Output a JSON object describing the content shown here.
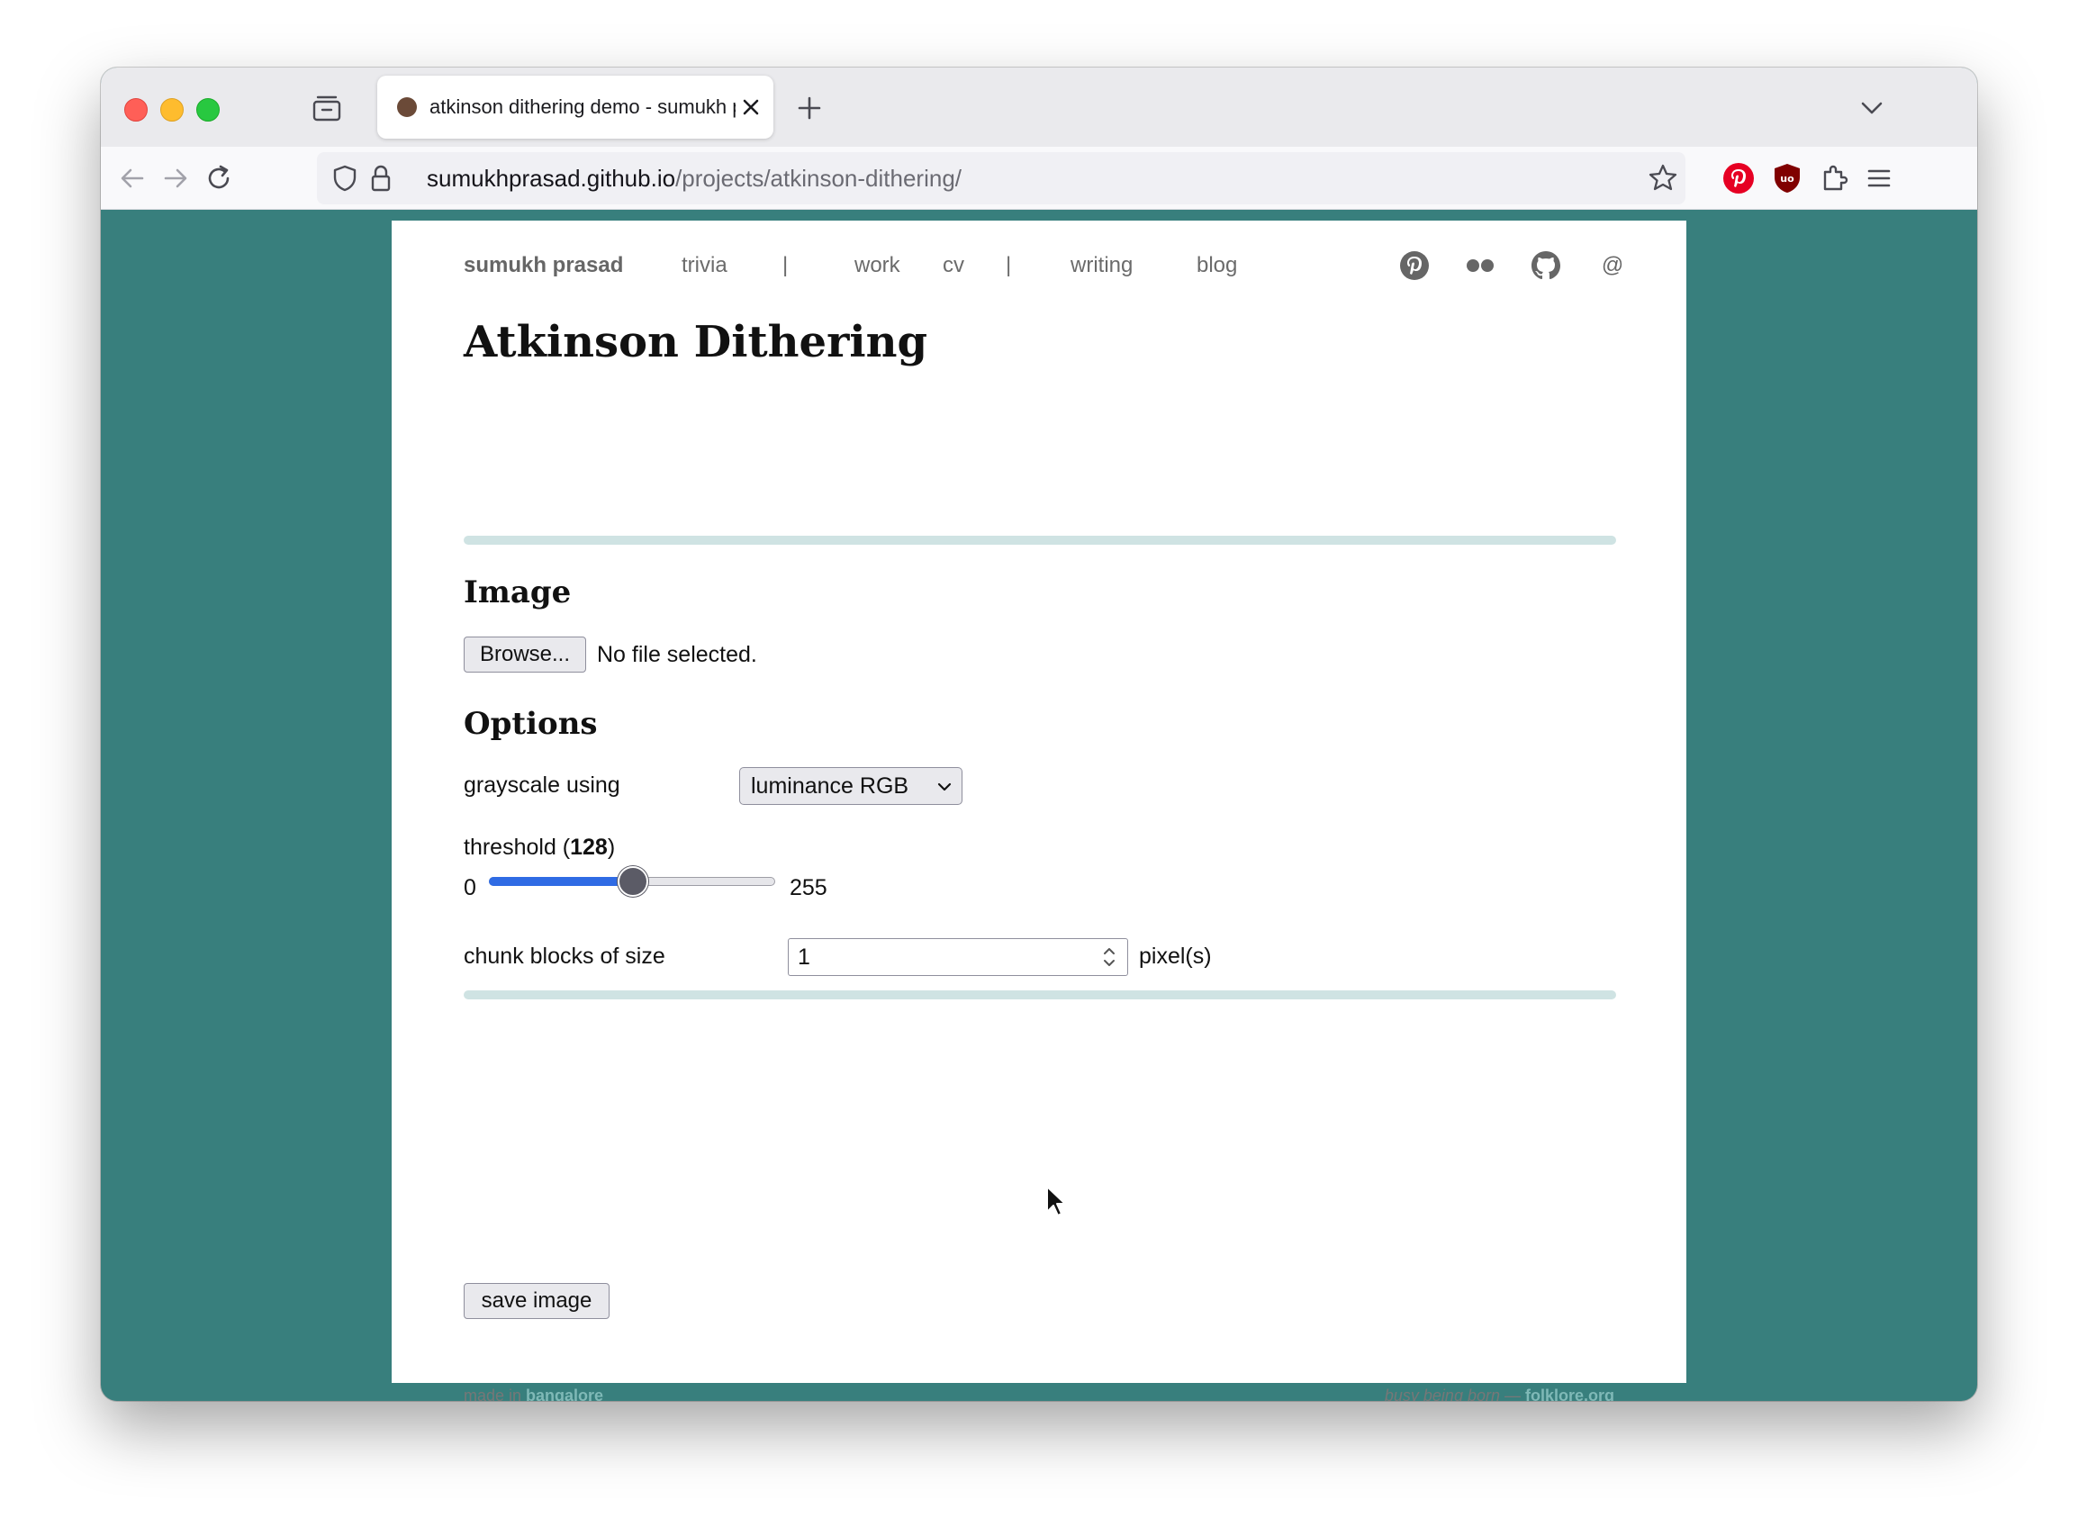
{
  "browser": {
    "tab_title": "atkinson dithering demo - sumukh prasad",
    "url_host": "sumukhprasad.github.io",
    "url_path": "/projects/atkinson-dithering/"
  },
  "site_nav": {
    "brand": "sumukh prasad",
    "items": [
      "trivia",
      "|",
      "work",
      "cv",
      "|",
      "writing",
      "blog"
    ],
    "social_icons": [
      "pinterest-icon",
      "flickr-icon",
      "github-icon",
      "at-icon"
    ],
    "at_label": "@"
  },
  "page": {
    "title": "Atkinson Dithering",
    "image_heading": "Image",
    "browse_label": "Browse...",
    "file_status": "No file selected.",
    "options_heading": "Options",
    "grayscale_label": "grayscale using",
    "grayscale_value": "luminance RGB",
    "threshold_label_prefix": "threshold (",
    "threshold_value": "128",
    "threshold_label_suffix": ")",
    "threshold_min": "0",
    "threshold_max": "255",
    "threshold_fraction": 0.502,
    "chunk_label": "chunk blocks of size",
    "chunk_value": "1",
    "chunk_unit": "pixel(s)",
    "save_label": "save image"
  },
  "footer": {
    "left_prefix": "made in ",
    "left_link": "bangalore",
    "right_prefix": "busy being born — ",
    "right_link": "folklore.org"
  },
  "colors": {
    "page_bg": "#387f7d",
    "accent_rule": "#cfe3e3",
    "slider_fill": "#2f6be4",
    "link": "#7fb9b7"
  }
}
